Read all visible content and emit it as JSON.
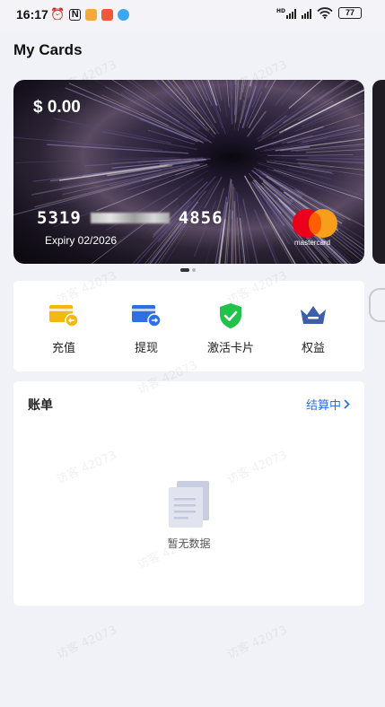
{
  "status_bar": {
    "time": "16:17",
    "battery": "77",
    "hd_label": "HD"
  },
  "page": {
    "title": "My Cards"
  },
  "card": {
    "balance": "$ 0.00",
    "number_first": "5319",
    "number_last": "4856",
    "expiry": "Expiry 02/2026",
    "brand": "mastercard"
  },
  "pager": {
    "total": 2,
    "active": 1
  },
  "actions": [
    {
      "label": "充值",
      "icon": "recharge-card-icon"
    },
    {
      "label": "提现",
      "icon": "withdraw-card-icon"
    },
    {
      "label": "激活卡片",
      "icon": "activate-shield-icon"
    },
    {
      "label": "权益",
      "icon": "crown-icon"
    }
  ],
  "bill": {
    "title": "账单",
    "link": "结算中",
    "empty_text": "暂无数据"
  },
  "watermark": {
    "text": "访客 42073"
  },
  "colors": {
    "accent_blue": "#2e6ee6",
    "yellow": "#f5b80f",
    "green": "#21c24a",
    "crown": "#3e5ea8"
  }
}
